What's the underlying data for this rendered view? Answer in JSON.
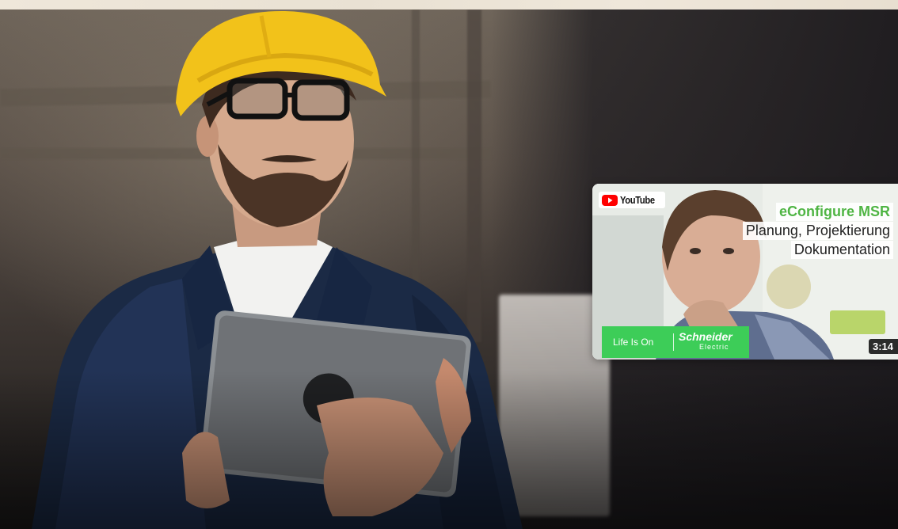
{
  "youtube_card": {
    "platform_label": "YouTube",
    "title_line1": "eConfigure MSR",
    "title_line2": "Planung, Projektierung",
    "title_line3": "Dokumentation",
    "tagline": "Life Is On",
    "brand": "Schneider",
    "brand_sub": "Electric",
    "duration": "3:14"
  },
  "colors": {
    "youtube_red": "#ff0000",
    "schneider_green": "#3dcd58",
    "title_green": "#4fb544"
  },
  "icons": [
    "youtube-play-icon"
  ]
}
